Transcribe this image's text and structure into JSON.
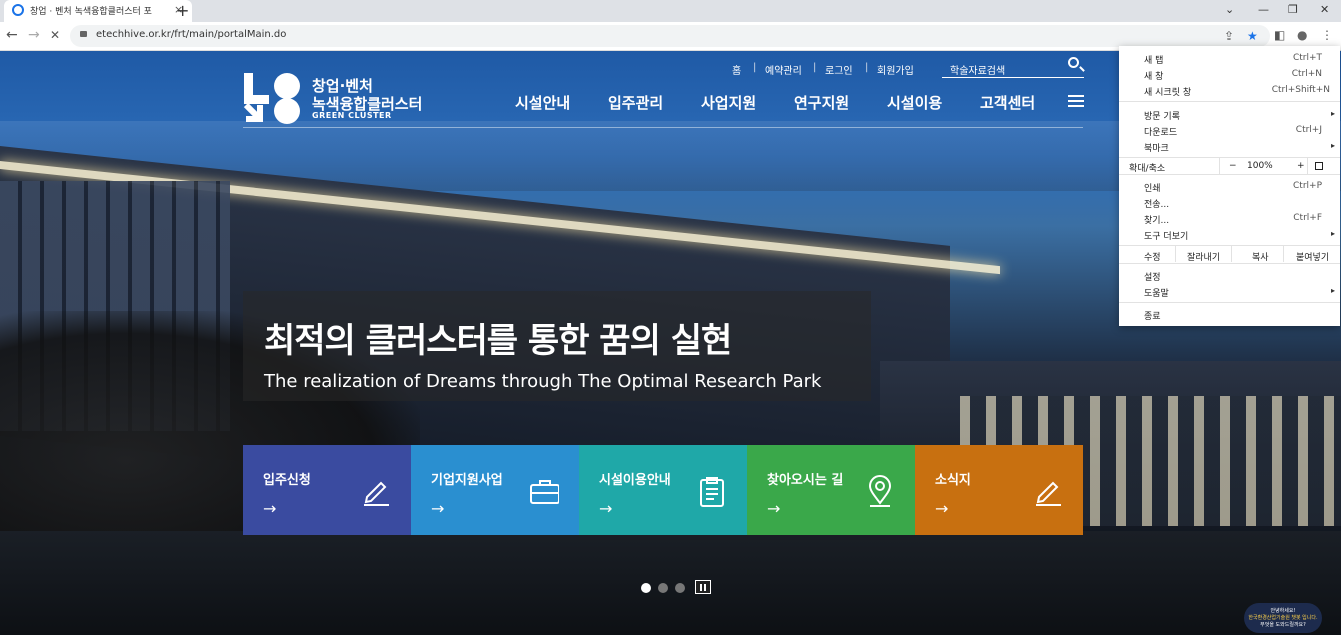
{
  "browser": {
    "tab_title": "창업 · 벤처 녹색융합클러스터 포",
    "tab_close": "×",
    "new_tab": "+",
    "win_min": "—",
    "win_max": "❐",
    "win_close": "✕",
    "win_dropdown": "⌄",
    "back": "←",
    "forward": "→",
    "reload": "✕",
    "url": "etechhive.or.kr/frt/main/portalMain.do",
    "share_glyph": "⇪",
    "star_glyph": "★",
    "sidepanel_glyph": "◧",
    "profile_glyph": "●",
    "more_glyph": "⋮"
  },
  "header": {
    "logo_line1": "창업·벤처",
    "logo_line2": "녹색융합클러스터",
    "logo_line3": "GREEN CLUSTER",
    "util": [
      "홈",
      "예약관리",
      "로그인",
      "회원가입"
    ],
    "search_placeholder": "학술자료검색",
    "gnb": [
      "시설안내",
      "입주관리",
      "사업지원",
      "연구지원",
      "시설이용",
      "고객센터"
    ]
  },
  "hero": {
    "title_ko": "최적의 클러스터를 통한 꿈의 실현",
    "title_en": "The realization of Dreams through The Optimal Research Park"
  },
  "quick_menu": [
    {
      "label": "입주신청",
      "color": "#3a4ba0",
      "icon": "pencil-icon"
    },
    {
      "label": "기업지원사업",
      "color": "#2a8fd0",
      "icon": "briefcase-icon"
    },
    {
      "label": "시설이용안내",
      "color": "#1fa8a8",
      "icon": "clipboard-icon"
    },
    {
      "label": "찾아오시는 길",
      "color": "#3aa84a",
      "icon": "location-pin-icon"
    },
    {
      "label": "소식지",
      "color": "#c87010",
      "icon": "pencil-icon"
    }
  ],
  "quick_arrow": "→",
  "chatbot": {
    "line1": "안녕하세요!",
    "line2": "한국환경산업기술원 챗봇 입니다.",
    "line3": "무엇을 도와드릴까요?"
  },
  "chrome_menu": {
    "new_tab": "새 탭",
    "new_tab_sc": "Ctrl+T",
    "new_window": "새 창",
    "new_window_sc": "Ctrl+N",
    "incognito": "새 시크릿 창",
    "incognito_sc": "Ctrl+Shift+N",
    "history": "방문 기록",
    "downloads": "다운로드",
    "downloads_sc": "Ctrl+J",
    "bookmarks": "북마크",
    "zoom_label": "확대/축소",
    "zoom_minus": "−",
    "zoom_value": "100%",
    "zoom_plus": "+",
    "print": "인쇄",
    "print_sc": "Ctrl+P",
    "cast": "전송...",
    "find": "찾기...",
    "find_sc": "Ctrl+F",
    "more_tools": "도구 더보기",
    "edit": "수정",
    "cut": "잘라내기",
    "copy": "복사",
    "paste": "붙여넣기",
    "settings": "설정",
    "help": "도움말",
    "exit": "종료"
  }
}
